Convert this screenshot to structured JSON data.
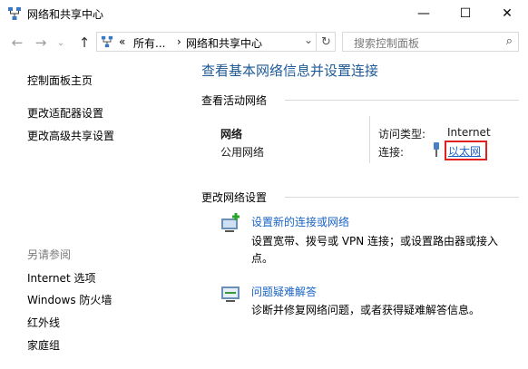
{
  "window": {
    "title": "网络和共享中心",
    "minimize": "—",
    "maximize": "☐",
    "close": "✕"
  },
  "address": {
    "back_icon": "arrow-left-icon",
    "forward_icon": "arrow-right-icon",
    "up_icon": "arrow-up-icon",
    "overflow": "«",
    "crumb1": "所有...",
    "sep": "›",
    "crumb2": "网络和共享中心",
    "dropdown": "⌄",
    "refresh": "↻"
  },
  "search": {
    "placeholder": "搜索控制面板"
  },
  "sidebar": {
    "items": [
      "控制面板主页",
      "更改适配器设置",
      "更改高级共享设置"
    ],
    "see_also_label": "另请参阅",
    "see_also": [
      "Internet 选项",
      "Windows 防火墙",
      "红外线",
      "家庭组"
    ]
  },
  "main": {
    "title": "查看基本网络信息并设置连接",
    "active_header": "查看活动网络",
    "network_name": "网络",
    "network_type": "公用网络",
    "access_type_label": "访问类型:",
    "access_type_value": "Internet",
    "connection_label": "连接:",
    "connection_value": "以太网",
    "change_header": "更改网络设置",
    "tasks": [
      {
        "link": "设置新的连接或网络",
        "desc": "设置宽带、拨号或 VPN 连接；或设置路由器或接入点。"
      },
      {
        "link": "问题疑难解答",
        "desc": "诊断并修复网络问题，或者获得疑难解答信息。"
      }
    ]
  }
}
